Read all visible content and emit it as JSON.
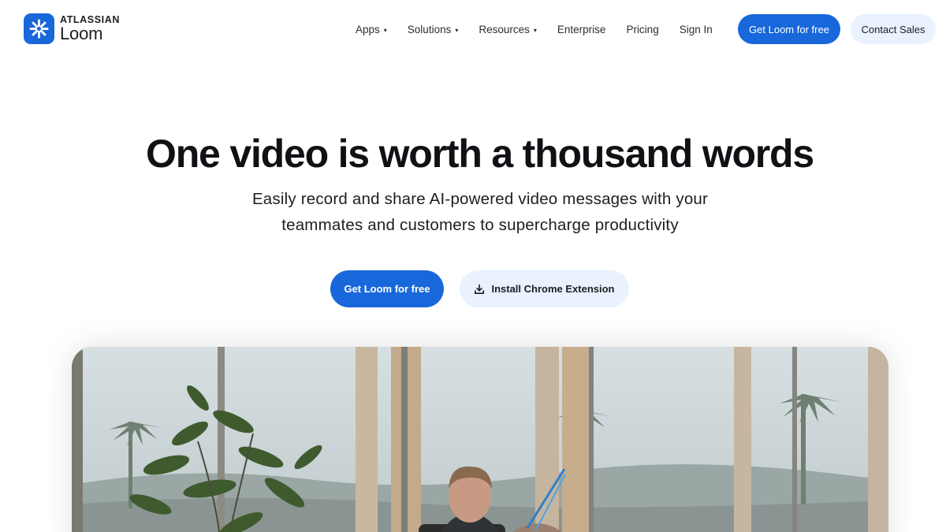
{
  "header": {
    "logo": {
      "brand": "ATLASSIAN",
      "product": "Loom",
      "icon": "loom-starburst-icon",
      "color": "#1868db"
    },
    "nav": [
      {
        "label": "Apps",
        "has_dropdown": true
      },
      {
        "label": "Solutions",
        "has_dropdown": true
      },
      {
        "label": "Resources",
        "has_dropdown": true
      },
      {
        "label": "Enterprise",
        "has_dropdown": false
      },
      {
        "label": "Pricing",
        "has_dropdown": false
      },
      {
        "label": "Sign In",
        "has_dropdown": false
      }
    ],
    "cta_primary": "Get Loom for free",
    "cta_contact": "Contact Sales",
    "caret": "▾"
  },
  "hero": {
    "title": "One video is worth a thousand words",
    "subtitle_line1": "Easily record and share AI-powered video messages with your",
    "subtitle_line2": "teammates and customers to supercharge productivity",
    "cta_primary": "Get Loom for free",
    "cta_secondary": "Install Chrome Extension",
    "cta_secondary_icon": "download-icon"
  },
  "video": {
    "description_icon": "hero-video-preview"
  },
  "colors": {
    "primary": "#1868db",
    "secondary_bg": "#e9f2fe",
    "text": "#1d1e22"
  }
}
